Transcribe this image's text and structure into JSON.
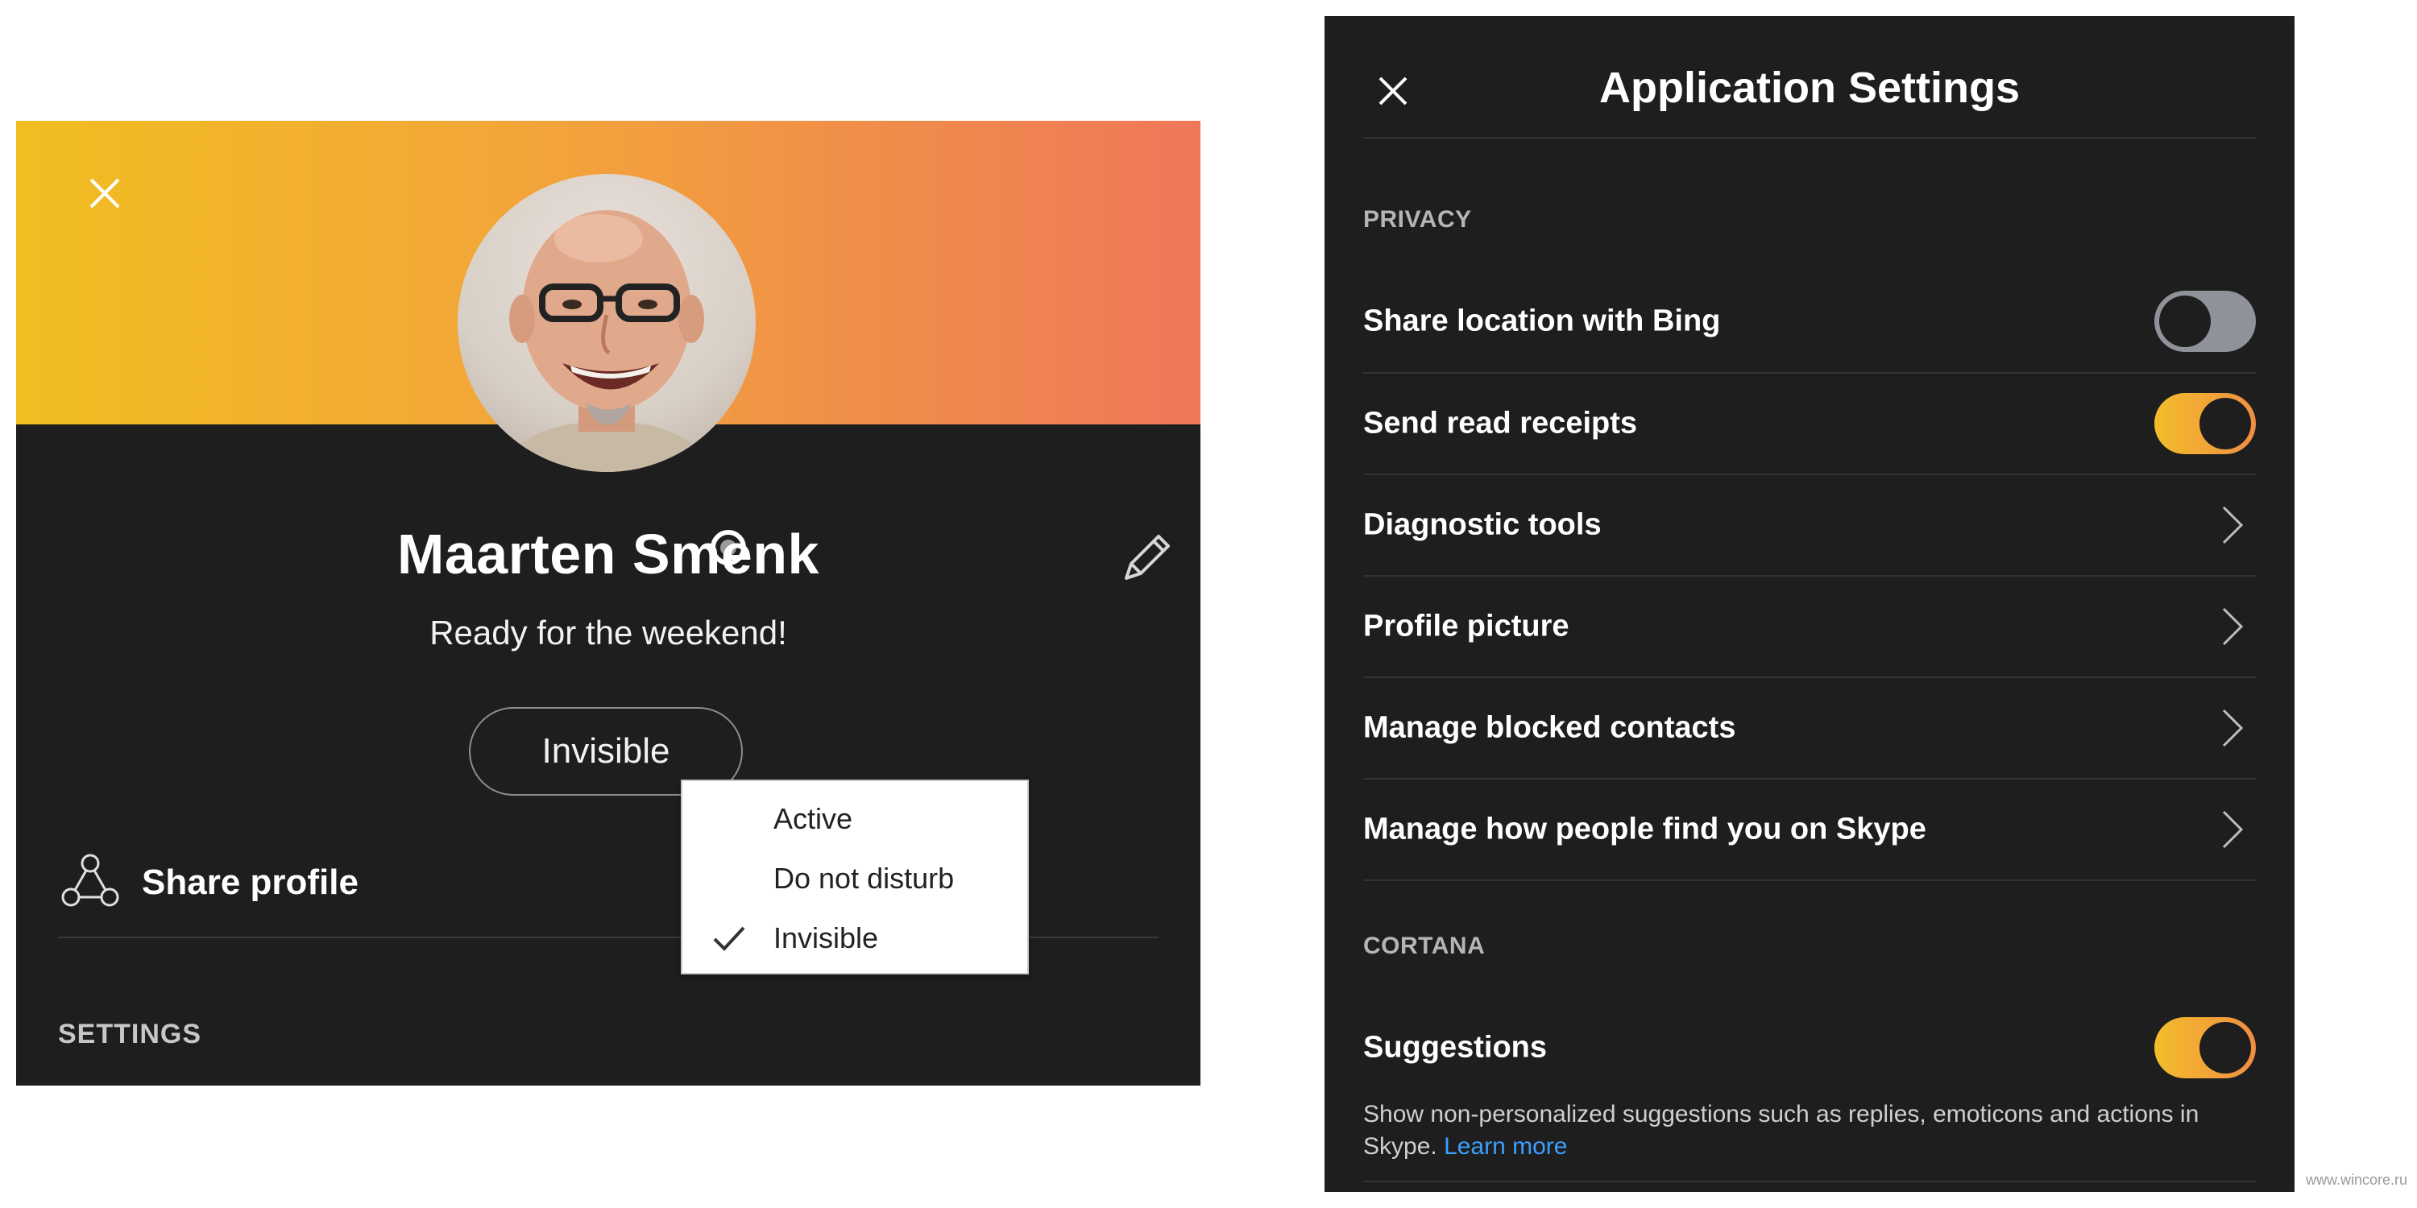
{
  "profile": {
    "close_icon": "close-icon",
    "name": "Maarten Smenk",
    "mood": "Ready for the weekend!",
    "status": "Invisible",
    "share_label": "Share profile",
    "settings_header": "SETTINGS",
    "banner_colors": [
      "#f1be21",
      "#ef7759"
    ],
    "status_menu": {
      "options": [
        "Active",
        "Do not disturb",
        "Invisible"
      ],
      "selected": "Invisible"
    }
  },
  "app_settings": {
    "title": "Application Settings",
    "privacy_label": "PRIVACY",
    "rows": [
      {
        "label": "Share location with Bing",
        "control": "toggle",
        "on": false
      },
      {
        "label": "Send read receipts",
        "control": "toggle",
        "on": true
      },
      {
        "label": "Diagnostic tools",
        "control": "chevron"
      },
      {
        "label": "Profile picture",
        "control": "chevron"
      },
      {
        "label": "Manage blocked contacts",
        "control": "chevron"
      },
      {
        "label": "Manage how people find you on Skype",
        "control": "chevron"
      }
    ],
    "cortana_label": "CORTANA",
    "suggestions": {
      "label": "Suggestions",
      "on": true,
      "description": "Show non-personalized suggestions such as replies, emoticons and actions in Skype.",
      "learn_more": "Learn more"
    }
  },
  "colors": {
    "panel_bg": "#1e1e1f",
    "accent_toggle": "#f3bd2b",
    "link": "#3aa0ff"
  },
  "watermark": "www.wincore.ru"
}
